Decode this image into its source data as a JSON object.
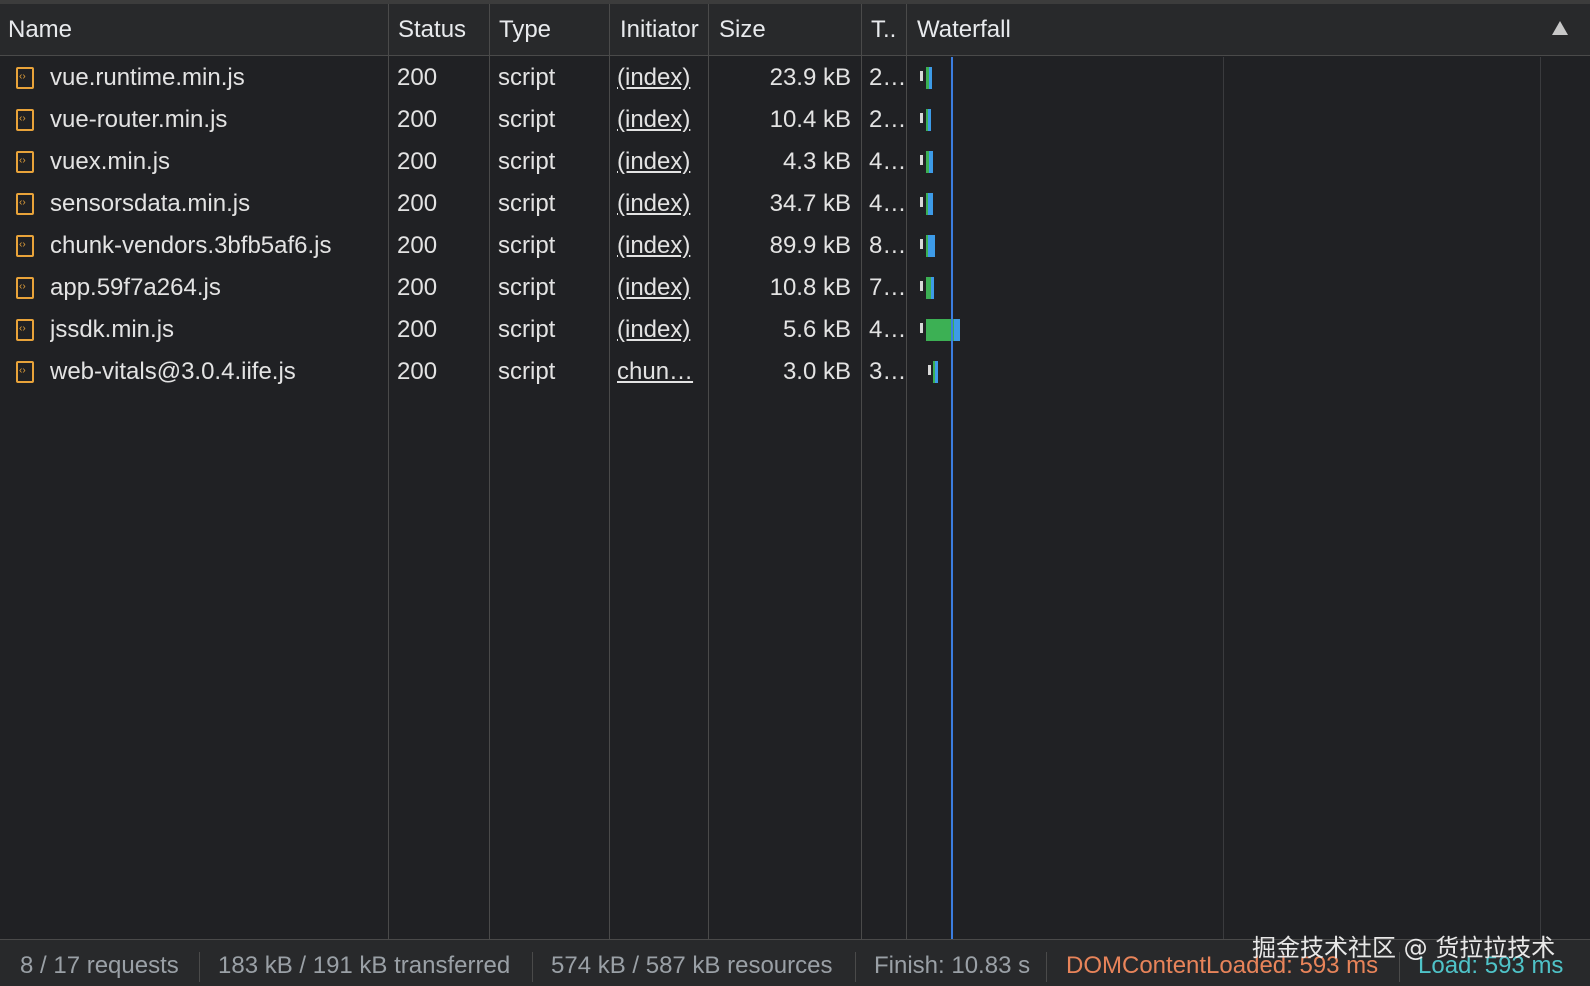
{
  "header": {
    "name": "Name",
    "status": "Status",
    "type": "Type",
    "initiator": "Initiator",
    "size": "Size",
    "time": "T..",
    "waterfall": "Waterfall"
  },
  "rows": [
    {
      "name": "vue.runtime.min.js",
      "status": "200",
      "type": "script",
      "initiator": "(index)",
      "size": "23.9 kB",
      "time": "2…"
    },
    {
      "name": "vue-router.min.js",
      "status": "200",
      "type": "script",
      "initiator": "(index)",
      "size": "10.4 kB",
      "time": "2…"
    },
    {
      "name": "vuex.min.js",
      "status": "200",
      "type": "script",
      "initiator": "(index)",
      "size": "4.3 kB",
      "time": "4…"
    },
    {
      "name": "sensorsdata.min.js",
      "status": "200",
      "type": "script",
      "initiator": "(index)",
      "size": "34.7 kB",
      "time": "4…"
    },
    {
      "name": "chunk-vendors.3bfb5af6.js",
      "status": "200",
      "type": "script",
      "initiator": "(index)",
      "size": "89.9 kB",
      "time": "8…"
    },
    {
      "name": "app.59f7a264.js",
      "status": "200",
      "type": "script",
      "initiator": "(index)",
      "size": "10.8 kB",
      "time": "7…"
    },
    {
      "name": "jssdk.min.js",
      "status": "200",
      "type": "script",
      "initiator": "(index)",
      "size": "5.6 kB",
      "time": "4…"
    },
    {
      "name": "web-vitals@3.0.4.iife.js",
      "status": "200",
      "type": "script",
      "initiator": "chun…",
      "size": "3.0 kB",
      "time": "3…"
    }
  ],
  "footer": {
    "requests": "8 / 17 requests",
    "transferred": "183 kB / 191 kB transferred",
    "resources": "574 kB / 587 kB resources",
    "finish": "Finish: 10.83 s",
    "dom_content_loaded": "DOMContentLoaded: 593 ms",
    "load": "Load: 593 ms"
  },
  "watermark": "掘金技术社区 @ 货拉拉技术",
  "colors": {
    "background": "#202124",
    "dom_content_loaded": "#e8845a",
    "load": "#4fc3c8",
    "waterfall_green": "#3cb054",
    "waterfall_blue": "#3d9be8",
    "load_line": "#3b7de0",
    "file_icon": "#e8a33a"
  },
  "icons": {
    "sort": "sort-ascending-icon",
    "file": "script-file-icon"
  }
}
